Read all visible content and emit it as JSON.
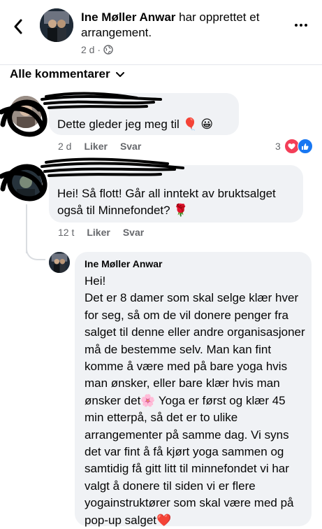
{
  "header": {
    "author": "Ine Møller Anwar",
    "action_text": " har opprettet et arrangement.",
    "time": "2 d ·",
    "icons": {
      "back": "chevron-left-icon",
      "more": "more-horizontal-icon",
      "privacy": "globe-icon"
    }
  },
  "sort": {
    "label": "Alle kommentarer"
  },
  "comments": [
    {
      "text": "Dette gleder jeg meg til 🎈 😀",
      "time": "2 d",
      "like_label": "Liker",
      "reply_label": "Svar",
      "reaction_count": "3"
    },
    {
      "text": "Hei! Så flott! Går all inntekt av bruktsalget også til Minnefondet? 🌹",
      "time": "12 t",
      "like_label": "Liker",
      "reply_label": "Svar"
    }
  ],
  "reply": {
    "author": "Ine Møller Anwar",
    "text": "Hei!\nDet er 8 damer som skal selge klær hver for seg, så om de vil donere penger fra salget til denne eller andre organisasjoner må de bestemme selv. Man kan fint komme å være med på bare yoga hvis man ønsker, eller bare klær hvis man ønsker det🌸 Yoga er først og klær 45 min etterpå, så det er to ulike arrangementer på samme dag. Vi syns det var fint å få kjørt yoga sammen og samtidig få gitt litt til minnefondet vi har valgt å donere til siden vi er flere yogainstruktører som skal være med på pop-up salget❤️"
  }
}
